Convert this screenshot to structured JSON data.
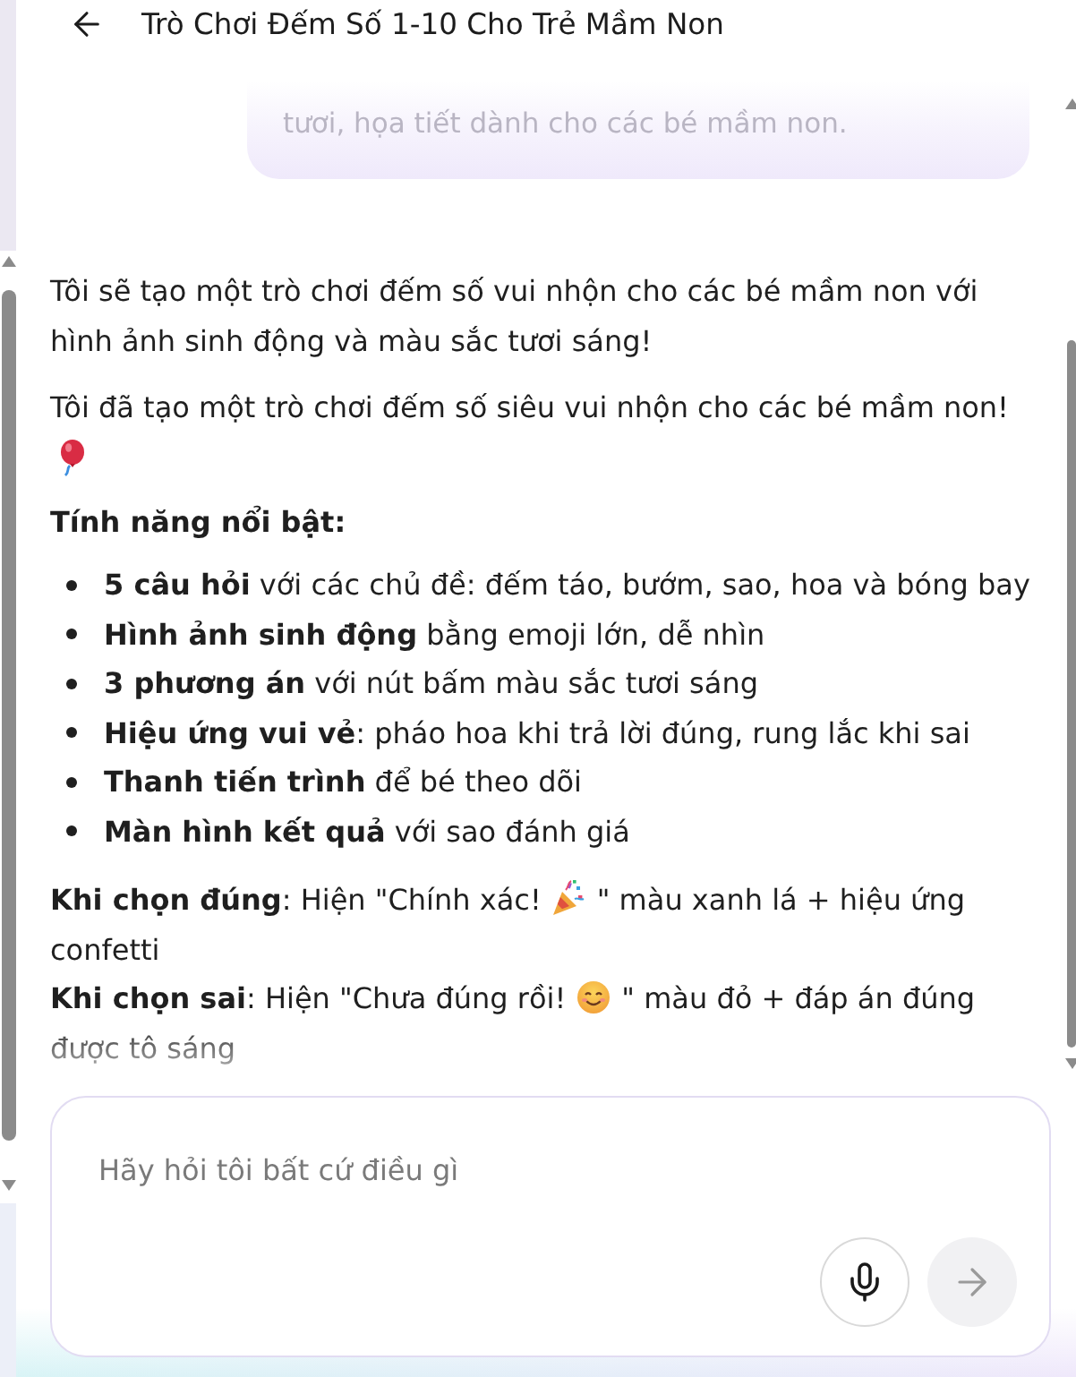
{
  "header": {
    "title": "Trò Chơi Đếm Số 1-10 Cho Trẻ Mầm Non"
  },
  "user_message": {
    "text": "tươi, họa tiết dành cho các bé mầm non."
  },
  "assistant_message": {
    "blocks": [
      {
        "kind": "paragraph",
        "segments": [
          "Tôi sẽ tạo một trò chơi đếm số vui nhộn cho các bé mầm non với hình ảnh sinh động và màu sắc tươi sáng!"
        ]
      },
      {
        "kind": "paragraph",
        "segments": [
          "Tôi đã tạo một trò chơi đếm số siêu vui nhộn cho các bé mầm non!"
        ]
      },
      {
        "kind": "heading",
        "segments": [
          "Tính năng nổi bật:"
        ]
      },
      {
        "kind": "list",
        "items": [
          "**5 câu hỏi** với các chủ đề: đếm táo, bướm, sao, hoa và bóng bay",
          "**Hình ảnh sinh động** bằng emoji lớn, dễ nhìn",
          "**3 phương án** với nút bấm màu sắc tươi sáng",
          "**Hiệu ứng vui vẻ**: pháo hoa khi trả lời đúng, rung lắc khi sai",
          "**Thanh tiến trình** để bé theo dõi",
          "**Màn hình kết quả** với sao đánh giá"
        ]
      },
      {
        "kind": "line",
        "segments": [
          "**Khi chọn đúng**: Hiện \"Chính xác!",
          "\" màu xanh lá + hiệu ứng confetti"
        ]
      },
      {
        "kind": "line",
        "segments": [
          "**Khi chọn sai**: Hiện \"Chưa đúng rồi!",
          "\" màu đỏ + đáp án đúng được tô sáng"
        ]
      }
    ]
  },
  "composer": {
    "placeholder": "Hãy hỏi tôi bất cứ điều gì"
  }
}
